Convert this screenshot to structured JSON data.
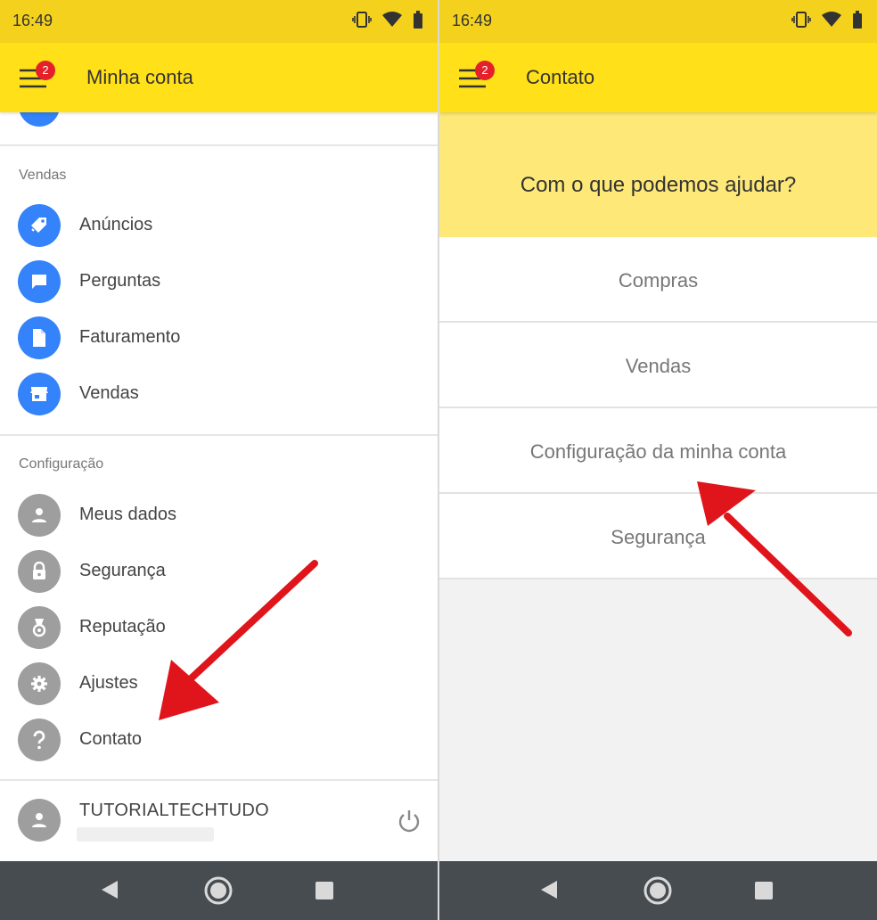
{
  "left_screen": {
    "status": {
      "time": "16:49"
    },
    "appbar": {
      "title": "Minha conta",
      "badge": "2"
    },
    "sections": {
      "vendas_title": "Vendas",
      "config_title": "Configuração"
    },
    "vendas_items": [
      {
        "label": "Anúncios",
        "icon": "tag-icon"
      },
      {
        "label": "Perguntas",
        "icon": "chat-bubble-icon"
      },
      {
        "label": "Faturamento",
        "icon": "document-icon"
      },
      {
        "label": "Vendas",
        "icon": "store-icon"
      }
    ],
    "config_items": [
      {
        "label": "Meus dados",
        "icon": "person-icon"
      },
      {
        "label": "Segurança",
        "icon": "lock-icon"
      },
      {
        "label": "Reputação",
        "icon": "medal-icon"
      },
      {
        "label": "Ajustes",
        "icon": "gear-icon"
      },
      {
        "label": "Contato",
        "icon": "help-icon"
      }
    ],
    "user": {
      "name": "TUTORIALTECHTUDO"
    }
  },
  "right_screen": {
    "status": {
      "time": "16:49"
    },
    "appbar": {
      "title": "Contato",
      "badge": "2"
    },
    "banner_question": "Com o que podemos ajudar?",
    "options": [
      "Compras",
      "Vendas",
      "Configuração da minha conta",
      "Segurança"
    ]
  },
  "colors": {
    "status_yellow": "#f4d11d",
    "appbar_yellow": "#ffe019",
    "banner_yellow": "#fde878",
    "blue_icon": "#3483fa",
    "grey_icon": "#9e9e9e",
    "badge_red": "#e5202a",
    "annotation_arrow": "#e0151b",
    "navbar_dark": "#474c51"
  }
}
